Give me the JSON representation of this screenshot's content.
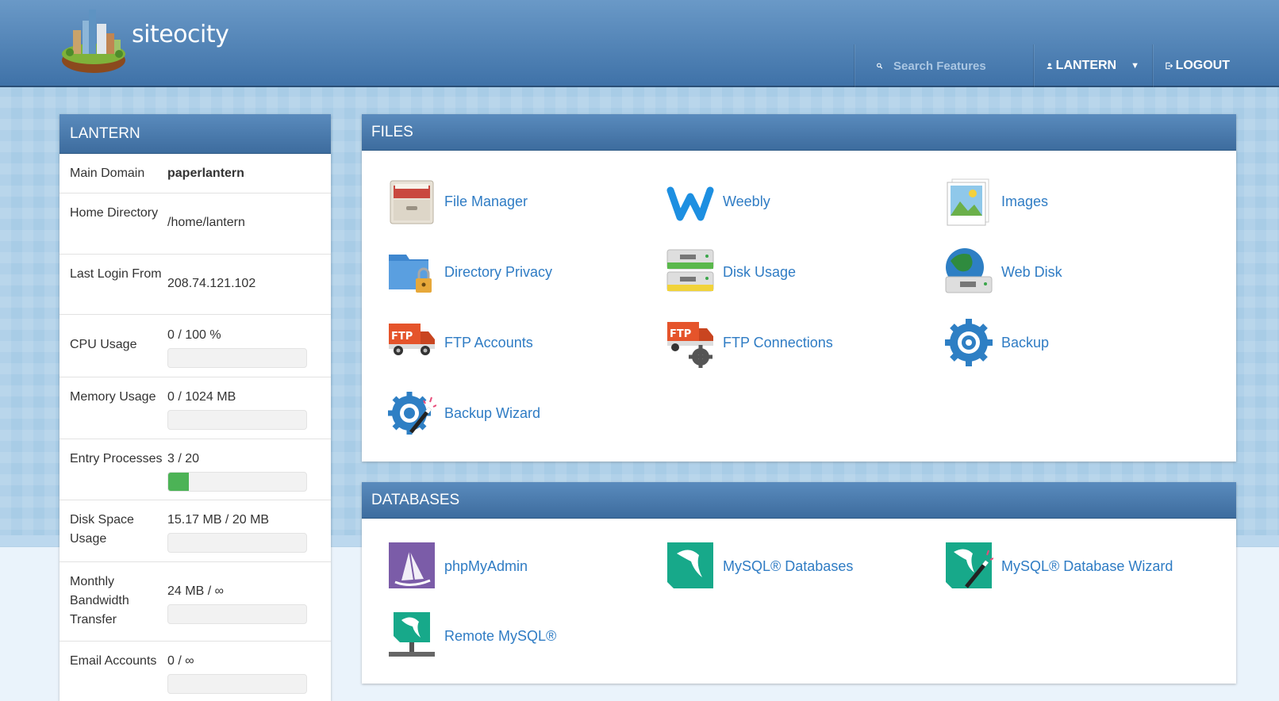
{
  "header": {
    "brand": "siteocity",
    "search_placeholder": "Search Features",
    "user_label": "LANTERN",
    "logout_label": "LOGOUT"
  },
  "account": {
    "title": "LANTERN",
    "rows": [
      {
        "label": "Main Domain",
        "value": "paperlantern"
      },
      {
        "label": "Home Directory",
        "value": "/home/lantern"
      },
      {
        "label": "Last Login From",
        "value": "208.74.121.102"
      },
      {
        "label": "CPU Usage",
        "value": "0 / 100 %",
        "usage": 0
      },
      {
        "label": "Memory Usage",
        "value": "0 / 1024 MB",
        "usage": 0
      },
      {
        "label": "Entry Processes",
        "value": "3 / 20",
        "usage": 0.15
      },
      {
        "label": "Disk Space Usage",
        "value": "15.17 MB / 20 MB",
        "usage": 0
      },
      {
        "label": "Monthly Bandwidth Transfer",
        "value": "24 MB / ∞",
        "usage": 0
      },
      {
        "label": "Email Accounts",
        "value": "0 / ∞",
        "usage": 0
      }
    ]
  },
  "files": {
    "title": "FILES",
    "items": [
      {
        "label": "File Manager",
        "icon": "file-manager-icon"
      },
      {
        "label": "Weebly",
        "icon": "weebly-icon"
      },
      {
        "label": "Images",
        "icon": "images-icon"
      },
      {
        "label": "Directory Privacy",
        "icon": "directory-privacy-icon"
      },
      {
        "label": "Disk Usage",
        "icon": "disk-usage-icon"
      },
      {
        "label": "Web Disk",
        "icon": "web-disk-icon"
      },
      {
        "label": "FTP Accounts",
        "icon": "ftp-accounts-icon"
      },
      {
        "label": "FTP Connections",
        "icon": "ftp-connections-icon"
      },
      {
        "label": "Backup",
        "icon": "backup-icon"
      },
      {
        "label": "Backup Wizard",
        "icon": "backup-wizard-icon"
      }
    ]
  },
  "databases": {
    "title": "DATABASES",
    "items": [
      {
        "label": "phpMyAdmin",
        "icon": "phpmyadmin-icon"
      },
      {
        "label": "MySQL® Databases",
        "icon": "mysql-databases-icon"
      },
      {
        "label": "MySQL® Database Wizard",
        "icon": "mysql-database-wizard-icon"
      },
      {
        "label": "Remote MySQL®",
        "icon": "remote-mysql-icon"
      }
    ]
  },
  "colors": {
    "header": "#4a7db2",
    "link": "#2f7cc4",
    "progress": "#4cb356",
    "mysql_green": "#17a98a"
  }
}
